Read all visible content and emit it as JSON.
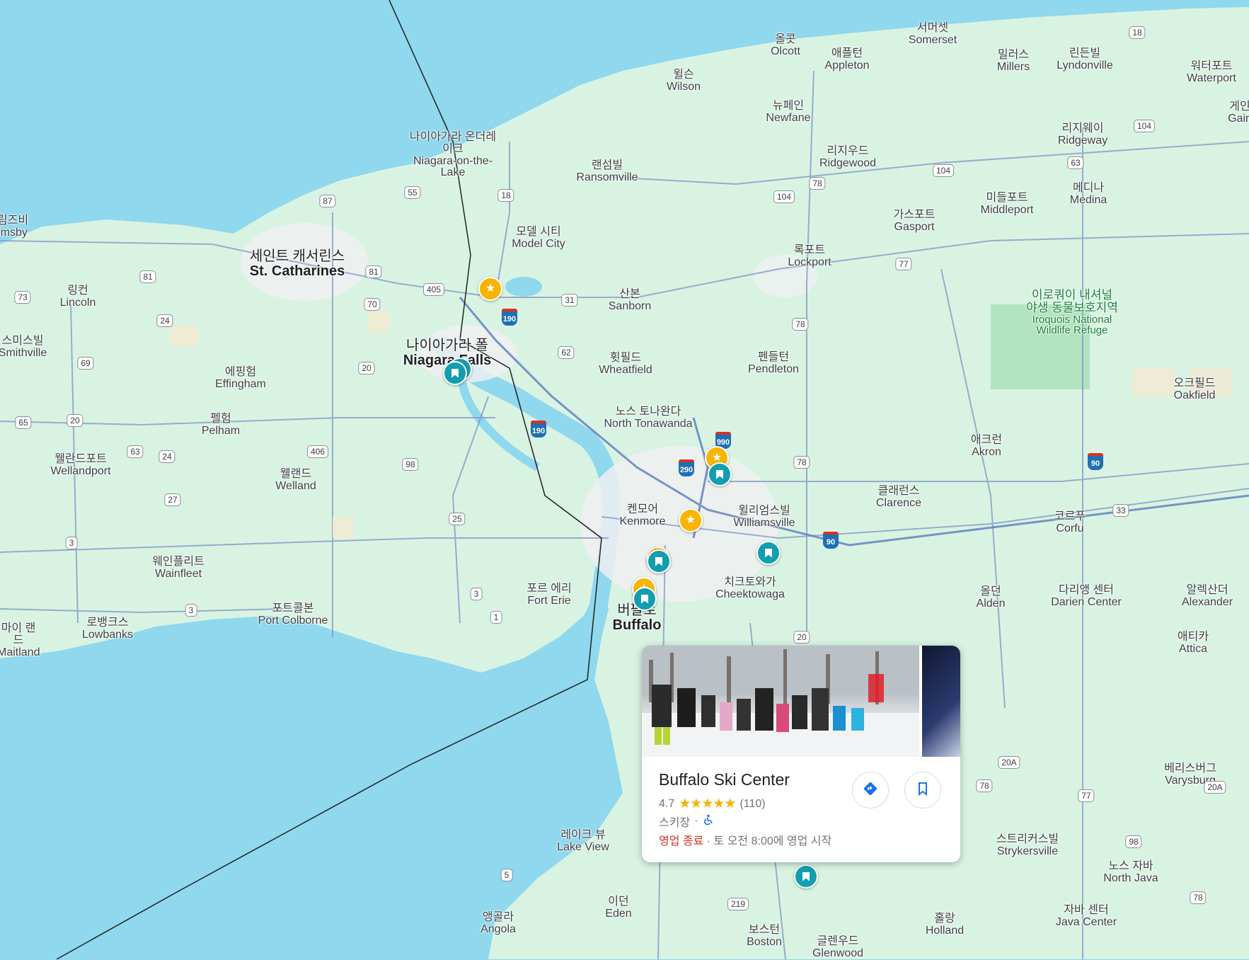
{
  "places": [
    {
      "ko": "올콧",
      "en": "Olcott"
    },
    {
      "ko": "서머셋",
      "en": "Somerset"
    },
    {
      "ko": "애플턴",
      "en": "Appleton"
    },
    {
      "ko": "밀러스",
      "en": "Millers"
    },
    {
      "ko": "린든빌",
      "en": "Lyndonville"
    },
    {
      "ko": "워터포트",
      "en": "Waterport"
    },
    {
      "ko": "윌슨",
      "en": "Wilson"
    },
    {
      "ko": "뉴페인",
      "en": "Newfane"
    },
    {
      "ko": "게인",
      "en": "Gain"
    },
    {
      "ko": "리지웨이",
      "en": "Ridgeway"
    },
    {
      "ko": "리지우드",
      "en": "Ridgewood"
    },
    {
      "ko": "나이아가라 온더레이크",
      "en": "Niagara-on-the-Lake"
    },
    {
      "ko": "랜섬빌",
      "en": "Ransomville"
    },
    {
      "ko": "미들포트",
      "en": "Middleport"
    },
    {
      "ko": "메디나",
      "en": "Medina"
    },
    {
      "ko": "가스포트",
      "en": "Gasport"
    },
    {
      "ko": "림즈비",
      "en": "imsby"
    },
    {
      "ko": "모델 시티",
      "en": "Model City"
    },
    {
      "ko": "세인트 캐서린스",
      "en": "St. Catharines"
    },
    {
      "ko": "록포트",
      "en": "Lockport"
    },
    {
      "ko": "링컨",
      "en": "Lincoln"
    },
    {
      "ko": "산본",
      "en": "Sanborn"
    },
    {
      "ko": "이로쿼이 내셔널 야생 동물보호지역",
      "en": "Iroquois National Wildlife Refuge"
    },
    {
      "ko": "스미스빌",
      "en": "Smithville"
    },
    {
      "ko": "나이아가라 폴",
      "en": "Niagara Falls"
    },
    {
      "ko": "휫필드",
      "en": "Wheatfield"
    },
    {
      "ko": "펜들턴",
      "en": "Pendleton"
    },
    {
      "ko": "에핑험",
      "en": "Effingham"
    },
    {
      "ko": "오크필드",
      "en": "Oakfield"
    },
    {
      "ko": "노스 토나완다",
      "en": "North Tonawanda"
    },
    {
      "ko": "펠험",
      "en": "Pelham"
    },
    {
      "ko": "애크런",
      "en": "Akron"
    },
    {
      "ko": "웰란드포트",
      "en": "Wellandport"
    },
    {
      "ko": "웰랜드",
      "en": "Welland"
    },
    {
      "ko": "클래런스",
      "en": "Clarence"
    },
    {
      "ko": "켄모어",
      "en": "Kenmore"
    },
    {
      "ko": "윌리엄스빌",
      "en": "Williamsville"
    },
    {
      "ko": "코르푸",
      "en": "Corfu"
    },
    {
      "ko": "웨인플리트",
      "en": "Wainfleet"
    },
    {
      "ko": "치크토와가",
      "en": "Cheektowaga"
    },
    {
      "ko": "포르 에리",
      "en": "Fort Erie"
    },
    {
      "ko": "올던",
      "en": "Alden"
    },
    {
      "ko": "다리앵 센터",
      "en": "Darien Center"
    },
    {
      "ko": "알렉산더",
      "en": "Alexander"
    },
    {
      "ko": "포트콜본",
      "en": "Port Colborne"
    },
    {
      "ko": "로뱅크스",
      "en": "Lowbanks"
    },
    {
      "ko": "마이 랜드",
      "en": "Maitland"
    },
    {
      "ko": "버팔로",
      "en": "Buffalo"
    },
    {
      "ko": "애티카",
      "en": "Attica"
    },
    {
      "ko": "베리스버그",
      "en": "Varysburg"
    },
    {
      "ko": "레이크 뷰",
      "en": "Lake View"
    },
    {
      "ko": "스트리커스빌",
      "en": "Strykersville"
    },
    {
      "ko": "노스 자바",
      "en": "North Java"
    },
    {
      "ko": "이던",
      "en": "Eden"
    },
    {
      "ko": "앵골라",
      "en": "Angola"
    },
    {
      "ko": "홀랑",
      "en": "Holland"
    },
    {
      "ko": "자바 센터",
      "en": "Java Center"
    },
    {
      "ko": "보스턴",
      "en": "Boston"
    },
    {
      "ko": "글렌우드",
      "en": "Glenwood"
    }
  ],
  "route_shields": [
    "18",
    "87",
    "55",
    "18",
    "104",
    "104",
    "104",
    "78",
    "63",
    "81",
    "405",
    "31",
    "81",
    "73",
    "24",
    "70",
    "77",
    "62",
    "78",
    "69",
    "20",
    "65",
    "20",
    "63",
    "24",
    "406",
    "98",
    "78",
    "27",
    "25",
    "33",
    "3",
    "3",
    "3",
    "1",
    "20",
    "20A",
    "78",
    "77",
    "20A",
    "98",
    "5",
    "219",
    "78"
  ],
  "interstate_shields": [
    "190",
    "190",
    "990",
    "290",
    "90",
    "90"
  ],
  "pins": {
    "starred_count": 5,
    "saved_count": 7,
    "starred_icon": "star-icon",
    "saved_icon": "bookmark-icon"
  },
  "place_card": {
    "title": "Buffalo Ski Center",
    "rating": "4.7",
    "stars": "★★★★★",
    "review_count": "(110)",
    "category": "스키장",
    "separator": "·",
    "status": "영업 종료",
    "hours": " · 토 오전 8:00에 영업 시작",
    "directions_icon": "directions-icon",
    "save_icon": "bookmark-icon",
    "accessibility_icon": "wheelchair-icon"
  },
  "colors": {
    "water": "#8fd8ee",
    "land": "#d9f3e2",
    "urban": "#eef0f2",
    "teal_pin": "#129eaf",
    "star_pin": "#f9b403",
    "closed": "#d93025"
  }
}
